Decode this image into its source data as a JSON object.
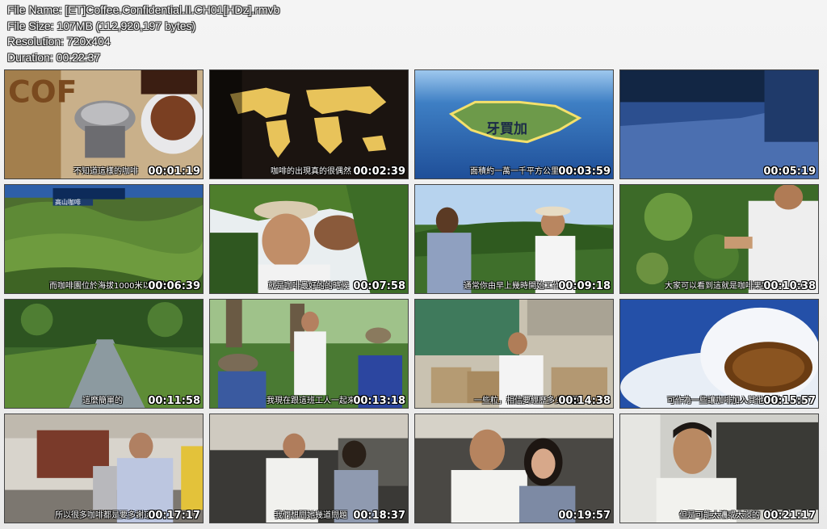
{
  "file_info": {
    "name_line": "File Name: [ET]Coffee.Confidential.II.CH01[HDz].rmvb",
    "size_line": "File Size: 107MB (112,920,197 bytes)",
    "resolution_line": "Resolution: 720x404",
    "duration_line": "Duration: 00:22:37"
  },
  "thumbnails": [
    {
      "time": "00:01:19",
      "subtitle": "不知道這樣的咖啡"
    },
    {
      "time": "00:02:39",
      "subtitle": "咖啡的出現真的很偶然"
    },
    {
      "time": "00:03:59",
      "subtitle": "面積約一萬一千平方公里",
      "map_label": "牙買加"
    },
    {
      "time": "00:05:19",
      "subtitle": ""
    },
    {
      "time": "00:06:39",
      "subtitle": "而咖啡園位於海拔1000米以上的",
      "banner": "高山咖啡"
    },
    {
      "time": "00:07:58",
      "subtitle": "就是咖啡最好的的時候"
    },
    {
      "time": "00:09:18",
      "subtitle": "通常你由早上幾時開始工作"
    },
    {
      "time": "00:10:38",
      "subtitle": "大家可以看到這就是咖啡果實"
    },
    {
      "time": "00:11:58",
      "subtitle": "這麼簡單的"
    },
    {
      "time": "00:13:18",
      "subtitle": "我現在跟這班工人一起來到"
    },
    {
      "time": "00:14:38",
      "subtitle": "一些粒，相信要經歷多少時間"
    },
    {
      "time": "00:15:57",
      "subtitle": "可作為一些讓咖啡加入其他咖啡"
    },
    {
      "time": "00:17:17",
      "subtitle": "所以很多咖啡都是要多謝這間"
    },
    {
      "time": "00:18:37",
      "subtitle": "我們想問她幾道問題"
    },
    {
      "time": "00:19:57",
      "subtitle": ""
    },
    {
      "time": "00:21:17",
      "subtitle": "但是可能太濃或太淡的"
    }
  ],
  "colors": {
    "frame_bg": "#ededed",
    "info_text": "#ffffff",
    "timestamp": "#ffffff"
  }
}
